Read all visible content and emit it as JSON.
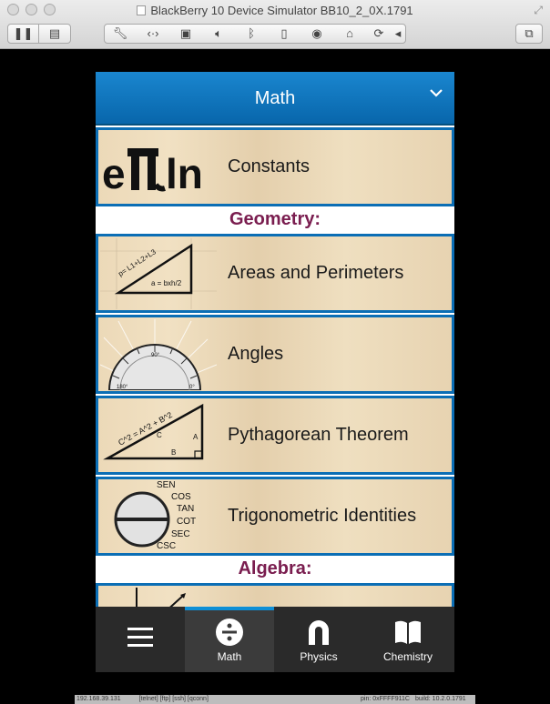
{
  "window": {
    "title": "BlackBerry 10 Device Simulator BB10_2_0X.1791"
  },
  "toolbar": {
    "icons": [
      "pause-icon",
      "snapshot-icon",
      "wrench-icon",
      "network-icon",
      "sim-card-icon",
      "volume-icon",
      "bluetooth-icon",
      "phone-icon",
      "camera-icon",
      "mouse-icon",
      "rotate-icon",
      "arrow-left-icon",
      "fullscreen-icon"
    ]
  },
  "app": {
    "title": "Math",
    "items": [
      {
        "label": "Constants",
        "icon": "constants-icon"
      },
      {
        "label": "Areas and Perimeters",
        "icon": "triangle-area-icon",
        "formula1": "p= L1+L2+L3",
        "formula2": "a = bxh/2"
      },
      {
        "label": "Angles",
        "icon": "protractor-icon",
        "deg1": "90°",
        "deg2": "180°",
        "deg3": "0°"
      },
      {
        "label": "Pythagorean Theorem",
        "icon": "right-triangle-icon",
        "formula": "C^2 = A^2 + B^2",
        "a": "A",
        "b": "B",
        "c": "C"
      },
      {
        "label": "Trigonometric Identities",
        "icon": "trig-circle-icon",
        "funcs": [
          "SEN",
          "COS",
          "TAN",
          "COT",
          "SEC",
          "CSC"
        ]
      },
      {
        "label": "",
        "icon": "algebra-partial-icon"
      }
    ],
    "sections": [
      {
        "label": "Geometry:"
      },
      {
        "label": "Algebra:"
      }
    ],
    "constants_glyphs": "eπln"
  },
  "tabs": [
    {
      "label": "",
      "icon": "menu-icon"
    },
    {
      "label": "Math",
      "icon": "divide-icon",
      "selected": true
    },
    {
      "label": "Physics",
      "icon": "magnet-icon"
    },
    {
      "label": "Chemistry",
      "icon": "book-icon"
    }
  ],
  "statusbar": {
    "ip": "192.168.39.131",
    "services": "[telnet]  [ftp]  [ssh]  [qconn]",
    "pin": "pin: 0xFFFF911C",
    "build": "build: 10.2.0.1791"
  },
  "colors": {
    "accent": "#0e8fd6",
    "section": "#7a1d4f",
    "titlebar": "#0d75bd"
  }
}
